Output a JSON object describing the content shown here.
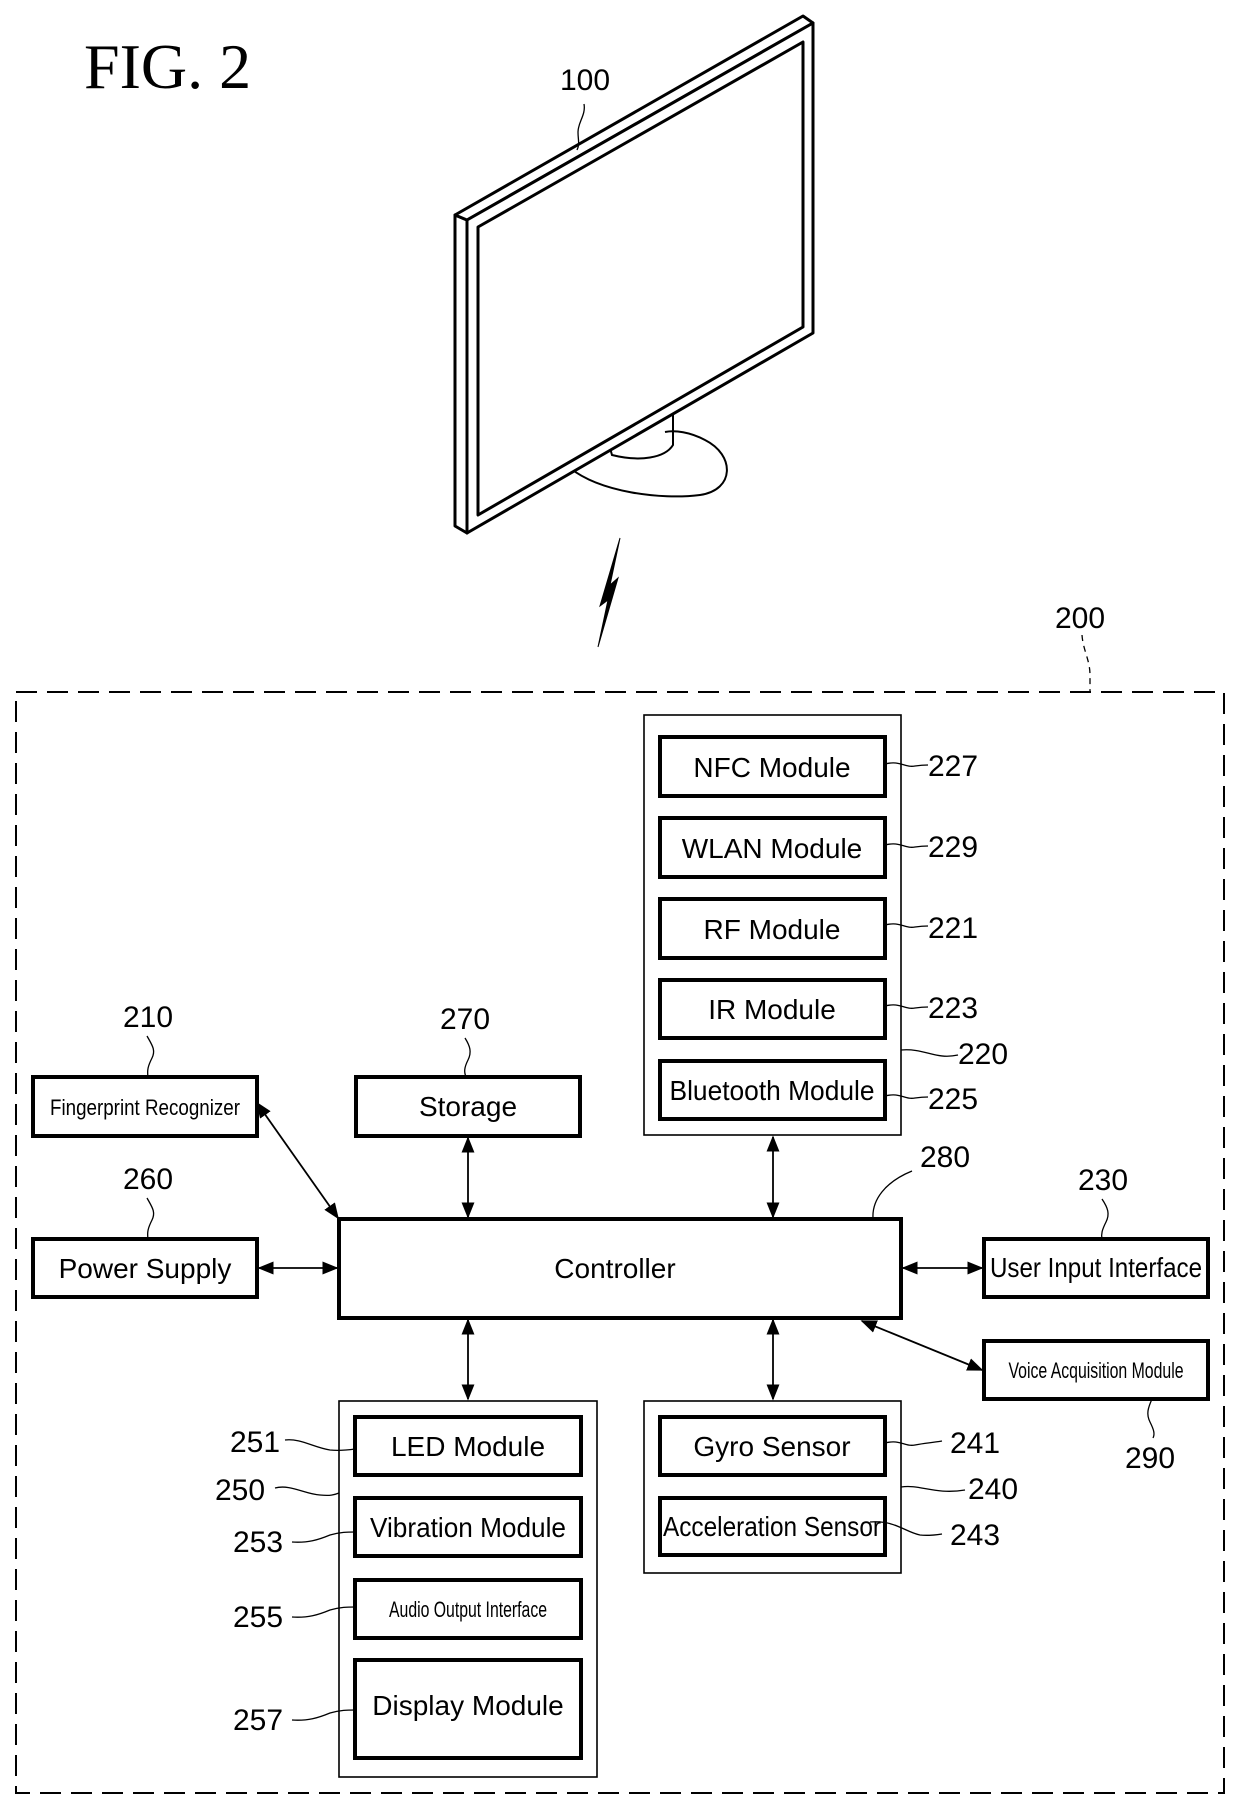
{
  "figure": {
    "title": "FIG. 2"
  },
  "display_device": {
    "ref": "100"
  },
  "remote_device": {
    "ref": "200"
  },
  "blocks": {
    "fingerprint": {
      "ref": "210",
      "label": "Fingerprint Recognizer"
    },
    "storage": {
      "ref": "270",
      "label": "Storage"
    },
    "power": {
      "ref": "260",
      "label": "Power Supply"
    },
    "controller": {
      "ref": "280",
      "label": "Controller"
    },
    "user_input": {
      "ref": "230",
      "label": "User Input Interface"
    },
    "voice": {
      "ref": "290",
      "label": "Voice Acquisition Module"
    }
  },
  "communicator": {
    "ref": "220",
    "modules": [
      {
        "ref": "227",
        "label": "NFC Module"
      },
      {
        "ref": "229",
        "label": "WLAN Module"
      },
      {
        "ref": "221",
        "label": "RF Module"
      },
      {
        "ref": "223",
        "label": "IR Module"
      },
      {
        "ref": "225",
        "label": "Bluetooth Module"
      }
    ]
  },
  "output_group": {
    "ref": "250",
    "modules": [
      {
        "ref": "251",
        "label": "LED Module"
      },
      {
        "ref": "253",
        "label": "Vibration Module"
      },
      {
        "ref": "255",
        "label": "Audio Output Interface"
      },
      {
        "ref": "257",
        "label": "Display Module"
      }
    ]
  },
  "sensor_group": {
    "ref": "240",
    "modules": [
      {
        "ref": "241",
        "label": "Gyro Sensor"
      },
      {
        "ref": "243",
        "label": "Acceleration Sensor"
      }
    ]
  }
}
